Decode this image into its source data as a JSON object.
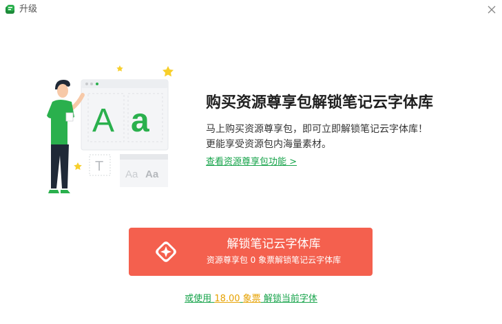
{
  "window": {
    "title": "升级",
    "app_icon": "app-logo-icon",
    "close_icon": "close-icon"
  },
  "promo": {
    "headline": "购买资源尊享包解锁笔记云字体库",
    "desc_line1": "马上购买资源尊享包，即可立即解锁笔记云字体库！",
    "desc_line2": "更能享受资源包内海量素材。",
    "feature_link": "查看资源尊享包功能 >"
  },
  "illustration": {
    "big_letters": "A a",
    "template_letter": "T",
    "sample_text_light": "Aa",
    "sample_text_bold": "Aa"
  },
  "unlock_button": {
    "main_label": "解锁笔记云字体库",
    "sub_label": "资源尊享包 0 象票解锁笔记云字体库",
    "icon": "diamond-star-icon"
  },
  "alt_option": {
    "prefix": "或使用",
    "price": "18.00",
    "currency": "象票",
    "action": "解锁当前字体"
  },
  "colors": {
    "accent_green": "#16a34a",
    "button_red": "#f4604e",
    "price_orange": "#e6a100"
  }
}
